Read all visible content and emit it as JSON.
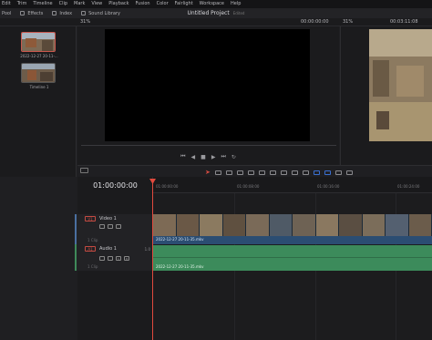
{
  "menu": [
    "Edit",
    "Trim",
    "Timeline",
    "Clip",
    "Mark",
    "View",
    "Playback",
    "Fusion",
    "Color",
    "Fairlight",
    "Workspace",
    "Help"
  ],
  "toolbar": {
    "left": "Pool",
    "effects": "Effects",
    "index": "Index",
    "sound_library": "Sound Library"
  },
  "title": {
    "project": "Untitled Project",
    "status": "Edited"
  },
  "viewer": {
    "zoom": "31%",
    "source_tc": "00:00:00:00",
    "program_zoom": "31%",
    "program_tc": "00:03:11:08"
  },
  "media_pool": {
    "clips": [
      {
        "label": "2022-12-27 20-11-..."
      },
      {
        "label": "Timeline 1"
      }
    ]
  },
  "timeline": {
    "timecode": "01:00:00:00",
    "ruler": [
      "01:00:00:00",
      "01:00:08:00",
      "01:00:16:00",
      "01:00:24:00"
    ],
    "video_track": {
      "badge": "V1",
      "name": "Video 1",
      "count": "1 Clip",
      "clip_label": "2022-12-27 20-11-35.mkv"
    },
    "audio_track": {
      "badge": "A1",
      "name": "Audio 1",
      "level": "1.0",
      "count": "1 Clip",
      "clip_label": "2022-12-27 20-11-35.mkv",
      "solo": "S",
      "mute": "M"
    }
  },
  "colors": {
    "playhead": "#e24a3e",
    "video_clip": "#2b4d72",
    "audio_clip": "#3c8b5b"
  }
}
